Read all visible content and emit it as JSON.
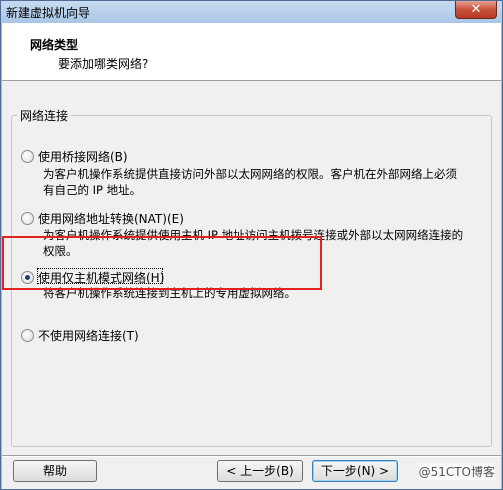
{
  "window": {
    "title": "新建虚拟机向导",
    "close_label": "✕"
  },
  "header": {
    "title": "网络类型",
    "subtitle": "要添加哪类网络?"
  },
  "group": {
    "label": "网络连接",
    "options": [
      {
        "label": "使用桥接网络(B)",
        "desc_lines": [
          "为客户机操作系统提供直接访问外部以太网网络的权限。客户机在外部网络上必须",
          "有自己的 IP 地址。"
        ],
        "checked": false
      },
      {
        "label": "使用网络地址转换(NAT)(E)",
        "desc_lines": [
          "为客户机操作系统提供使用主机 IP 地址访问主机拨号连接或外部以太网网络连接的",
          "权限。"
        ],
        "checked": false
      },
      {
        "label": "使用仅主机模式网络(H)",
        "desc_lines": [
          "将客户机操作系统连接到主机上的专用虚拟网络。"
        ],
        "checked": true
      },
      {
        "label": "不使用网络连接(T)",
        "desc_lines": [],
        "checked": false
      }
    ]
  },
  "buttons": {
    "help": "帮助",
    "back": "< 上一步(B)",
    "next": "下一步(N) >"
  },
  "watermark": "@51CTO博客"
}
